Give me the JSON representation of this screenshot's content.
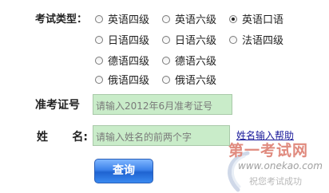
{
  "form": {
    "exam_type_label": "考试类型：",
    "exam_types": [
      {
        "label": "英语四级",
        "checked": false
      },
      {
        "label": "英语六级",
        "checked": false
      },
      {
        "label": "英语口语",
        "checked": true
      },
      {
        "label": "日语四级",
        "checked": false
      },
      {
        "label": "日语六级",
        "checked": false
      },
      {
        "label": "法语四级",
        "checked": false
      },
      {
        "label": "德语四级",
        "checked": false
      },
      {
        "label": "德语六级",
        "checked": false
      },
      {
        "label": "俄语四级",
        "checked": false
      },
      {
        "label": "俄语六级",
        "checked": false
      }
    ],
    "ticket_label": "准考证号",
    "ticket_input": {
      "placeholder": "请输入2012年6月准考证号",
      "value": ""
    },
    "name_label_chars": [
      "姓",
      "名:"
    ],
    "name_input": {
      "placeholder": "请输入姓名的前两个字",
      "value": ""
    },
    "name_help_link": "姓名输入帮助",
    "query_button": "查询"
  },
  "watermark": {
    "brand": "第一考试网",
    "url": "www.onekao.com",
    "slogan": "祝您考试成功"
  },
  "colors": {
    "input_bg": "#c9ecc9",
    "button_blue": "#3c82ea",
    "link": "#1a1a9a",
    "watermark_red": "#e08a7e"
  }
}
